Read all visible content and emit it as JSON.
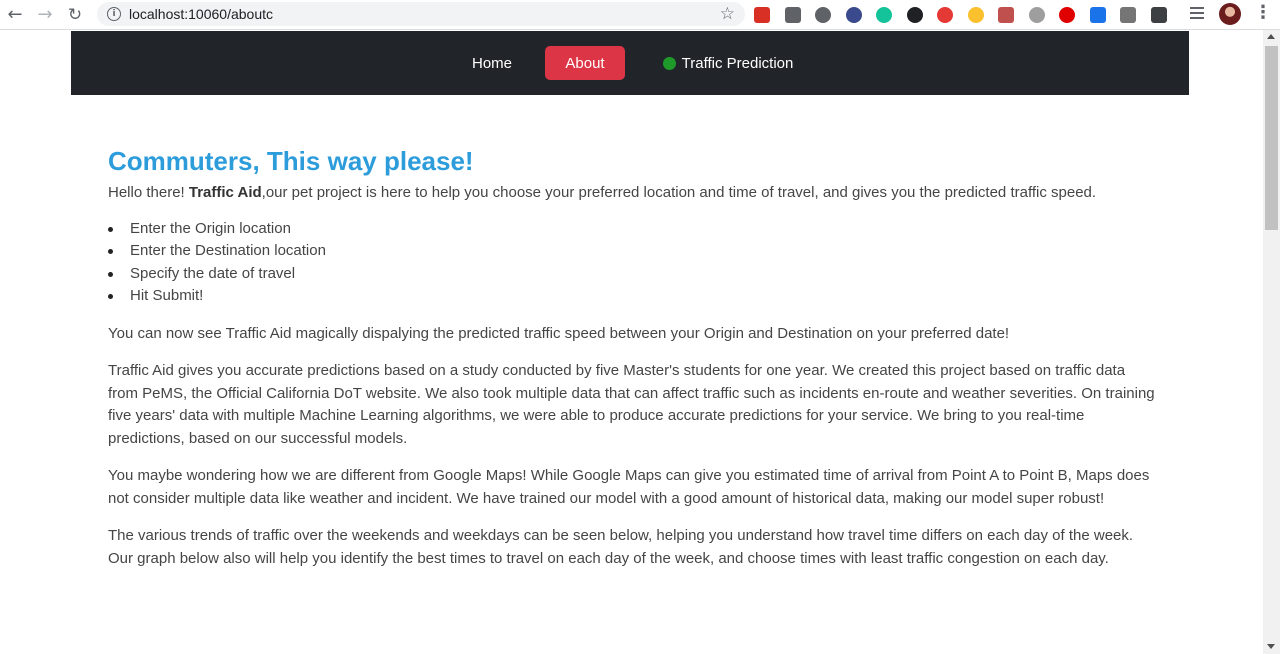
{
  "browser": {
    "url": "localhost:10060/aboutc"
  },
  "navbar": {
    "home_label": "Home",
    "about_label": "About",
    "traffic_label": "Traffic Prediction",
    "active_color": "#dc3545",
    "bg_color": "#212529"
  },
  "main": {
    "heading": "Commuters, This way please!",
    "intro_prefix": "Hello there! ",
    "intro_bold": "Traffic Aid",
    "intro_suffix": ",our pet project is here to help you choose your preferred location and time of travel, and gives you the predicted traffic speed.",
    "steps": [
      "Enter the Origin location",
      "Enter the Destination location",
      "Specify the date of travel",
      "Hit Submit!"
    ],
    "para1": "You can now see Traffic Aid magically dispalying the predicted traffic speed between your Origin and Destination on your preferred date!",
    "para2": "Traffic Aid gives you accurate predictions based on a study conducted by five Master's students for one year. We created this project based on traffic data from PeMS, the Official California DoT website. We also took multiple data that can affect traffic such as incidents en-route and weather severities. On training five years' data with multiple Machine Learning algorithms, we were able to produce accurate predictions for your service. We bring to you real-time predictions, based on our successful models.",
    "para3": "You maybe wondering how we are different from Google Maps! While Google Maps can give you estimated time of arrival from Point A to Point B, Maps does not consider multiple data like weather and incident. We have trained our model with a good amount of historical data, making our model super robust!",
    "para4": "The various trends of traffic over the weekends and weekdays can be seen below, helping you understand how travel time differs on each day of the week. Our graph below also will help you identify the best times to travel on each day of the week, and choose times with least traffic congestion on each day.",
    "heading_color": "#2d9cdb"
  }
}
